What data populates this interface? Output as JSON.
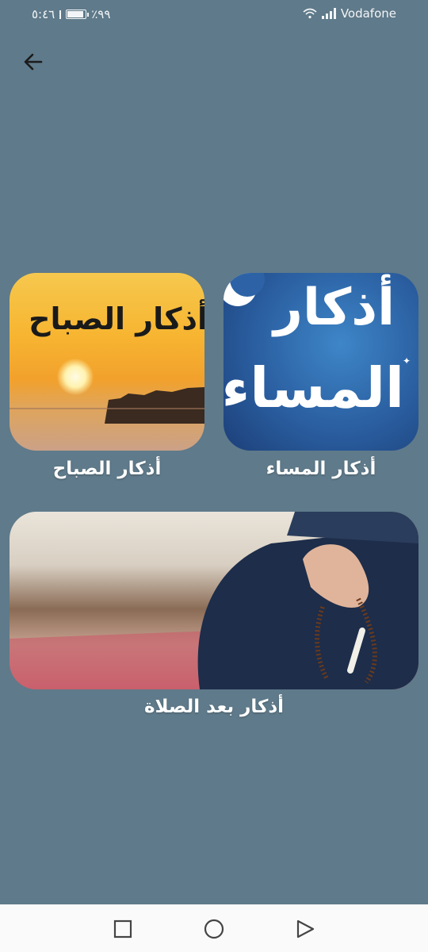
{
  "status_bar": {
    "time": "٥:٤٦",
    "battery_percent": "٪٩٩",
    "battery_level": 0.99,
    "carrier": "Vodafone"
  },
  "tiles": {
    "morning": {
      "image_text": "أذكار الصباح",
      "caption": "أذكار الصباح"
    },
    "evening": {
      "image_text_line1": "أذكار",
      "image_text_line2": "المساء",
      "caption": "أذكار المساء"
    },
    "after_prayer": {
      "caption": "أذكار بعد الصلاة"
    }
  },
  "icons": {
    "back": "arrow-left-icon",
    "nav_recent": "square-icon",
    "nav_home": "circle-icon",
    "nav_back": "triangle-icon"
  },
  "colors": {
    "background": "#5f7a8a",
    "caption_text": "#ffffff",
    "nav_bar": "#fafafa"
  }
}
